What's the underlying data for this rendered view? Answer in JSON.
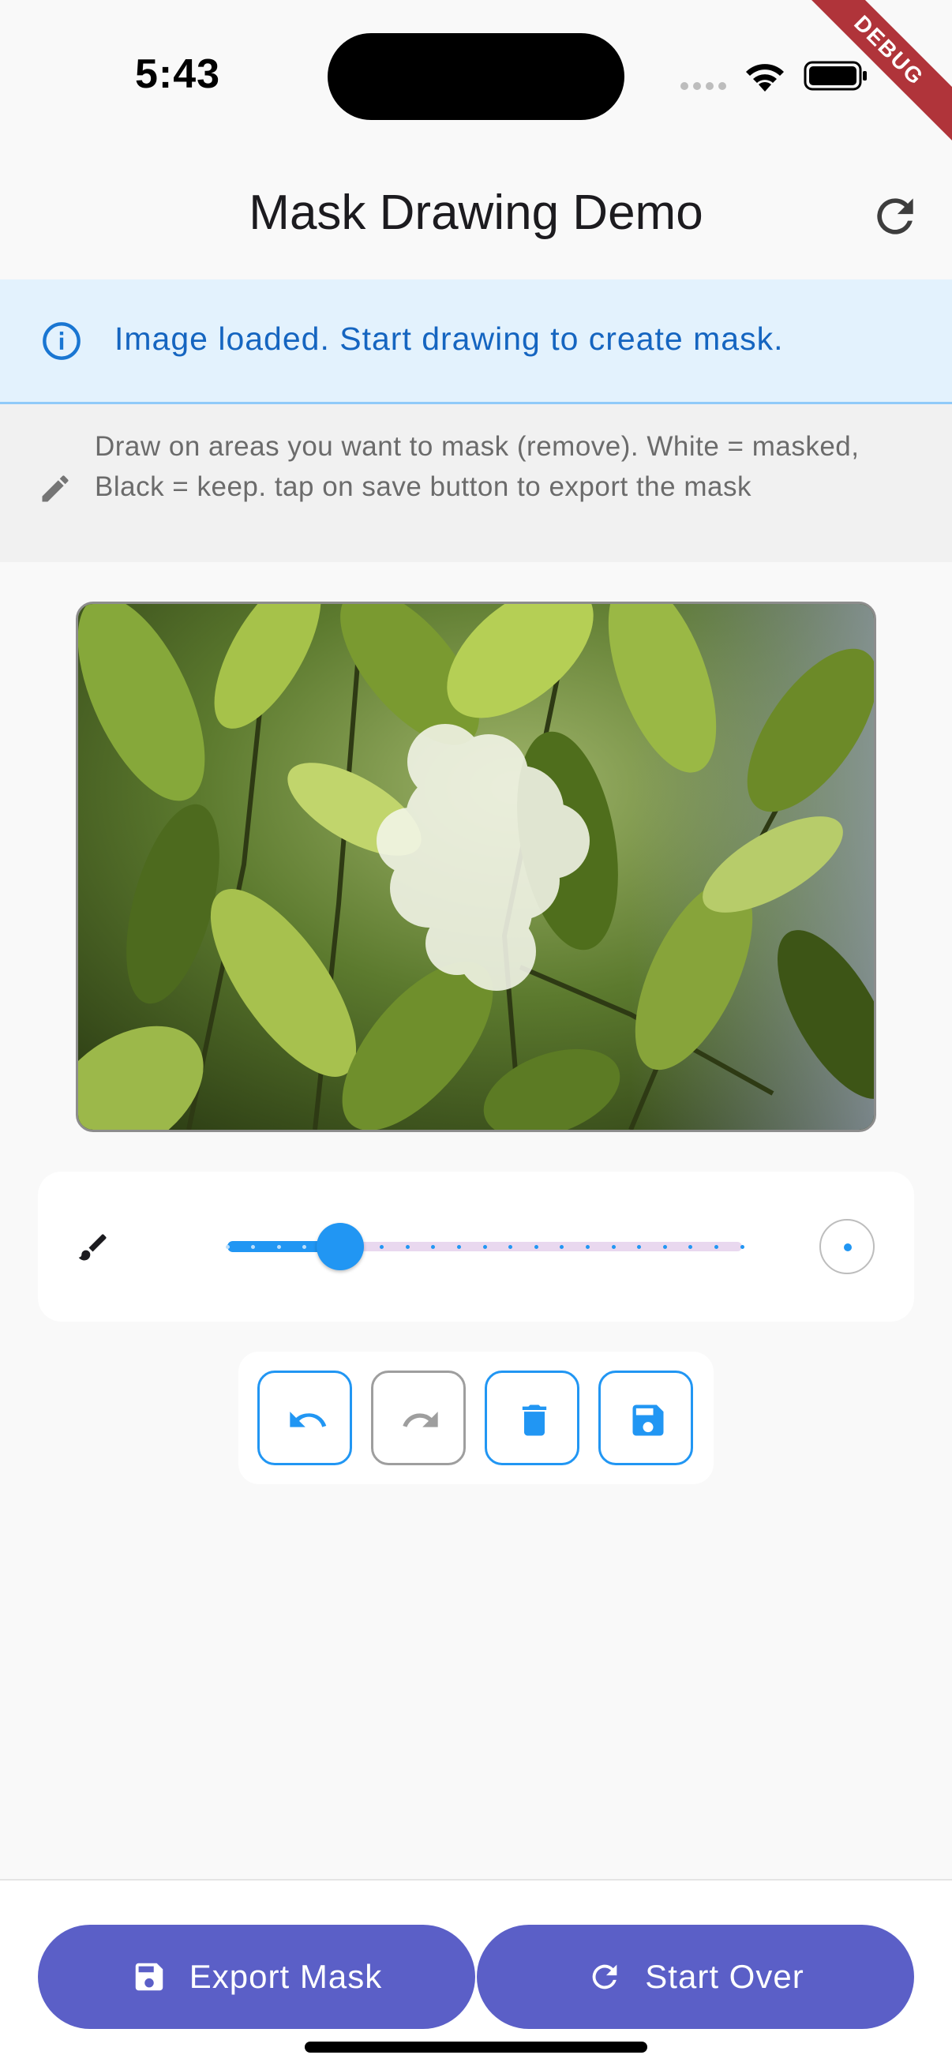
{
  "status_bar": {
    "time": "5:43"
  },
  "debug_banner": "DEBUG",
  "app_bar": {
    "title": "Mask Drawing Demo",
    "refresh_icon": "refresh-icon"
  },
  "info_banner": {
    "icon": "info-icon",
    "text": "Image loaded. Start drawing to create mask."
  },
  "instructions": {
    "icon": "pen-icon",
    "text": "Draw on areas you want to mask (remove). White = masked, Black = keep.  tap on save button to export the mask"
  },
  "brush": {
    "icon": "brush-icon",
    "size_fraction": 0.22,
    "tick_count": 20
  },
  "tools": [
    {
      "name": "undo-button",
      "icon": "undo-icon",
      "enabled": true
    },
    {
      "name": "redo-button",
      "icon": "redo-icon",
      "enabled": false
    },
    {
      "name": "clear-button",
      "icon": "trash-icon",
      "enabled": true
    },
    {
      "name": "save-button",
      "icon": "save-icon",
      "enabled": true
    }
  ],
  "actions": {
    "export_label": "Export Mask",
    "start_over_label": "Start Over"
  },
  "colors": {
    "accent": "#2196f3",
    "action_button": "#5b5fc7",
    "info_background": "#e3f2fd",
    "info_text": "#1565c0"
  }
}
